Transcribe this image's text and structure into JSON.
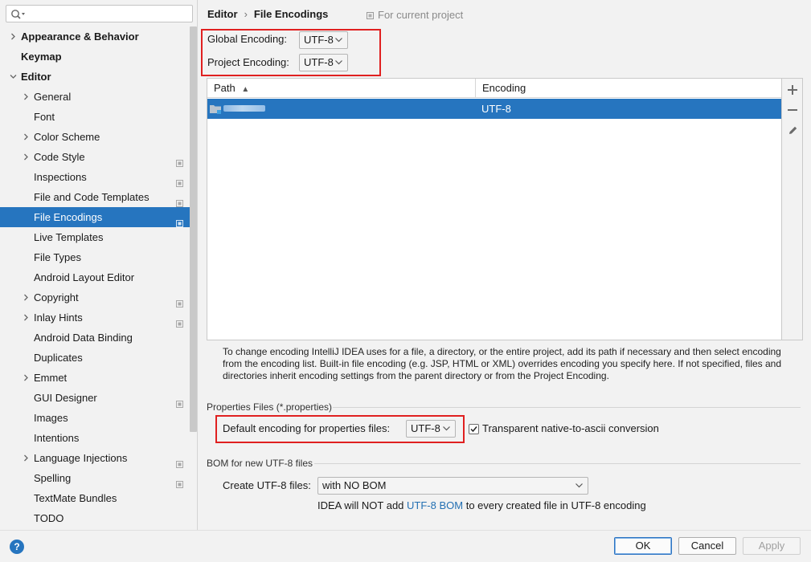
{
  "search": {
    "placeholder": ""
  },
  "sidebar": {
    "items": [
      {
        "label": "Appearance & Behavior",
        "level": 0,
        "expandable": true,
        "expanded": false,
        "project": false
      },
      {
        "label": "Keymap",
        "level": 0,
        "expandable": false,
        "expanded": false,
        "project": false
      },
      {
        "label": "Editor",
        "level": 0,
        "expandable": true,
        "expanded": true,
        "project": false
      },
      {
        "label": "General",
        "level": 1,
        "expandable": true,
        "expanded": false,
        "project": false
      },
      {
        "label": "Font",
        "level": 1,
        "expandable": false,
        "expanded": false,
        "project": false
      },
      {
        "label": "Color Scheme",
        "level": 1,
        "expandable": true,
        "expanded": false,
        "project": false
      },
      {
        "label": "Code Style",
        "level": 1,
        "expandable": true,
        "expanded": false,
        "project": true
      },
      {
        "label": "Inspections",
        "level": 1,
        "expandable": false,
        "expanded": false,
        "project": true
      },
      {
        "label": "File and Code Templates",
        "level": 1,
        "expandable": false,
        "expanded": false,
        "project": true
      },
      {
        "label": "File Encodings",
        "level": 1,
        "expandable": false,
        "expanded": false,
        "project": true,
        "selected": true
      },
      {
        "label": "Live Templates",
        "level": 1,
        "expandable": false,
        "expanded": false,
        "project": false
      },
      {
        "label": "File Types",
        "level": 1,
        "expandable": false,
        "expanded": false,
        "project": false
      },
      {
        "label": "Android Layout Editor",
        "level": 1,
        "expandable": false,
        "expanded": false,
        "project": false
      },
      {
        "label": "Copyright",
        "level": 1,
        "expandable": true,
        "expanded": false,
        "project": true
      },
      {
        "label": "Inlay Hints",
        "level": 1,
        "expandable": true,
        "expanded": false,
        "project": true
      },
      {
        "label": "Android Data Binding",
        "level": 1,
        "expandable": false,
        "expanded": false,
        "project": false
      },
      {
        "label": "Duplicates",
        "level": 1,
        "expandable": false,
        "expanded": false,
        "project": false
      },
      {
        "label": "Emmet",
        "level": 1,
        "expandable": true,
        "expanded": false,
        "project": false
      },
      {
        "label": "GUI Designer",
        "level": 1,
        "expandable": false,
        "expanded": false,
        "project": true
      },
      {
        "label": "Images",
        "level": 1,
        "expandable": false,
        "expanded": false,
        "project": false
      },
      {
        "label": "Intentions",
        "level": 1,
        "expandable": false,
        "expanded": false,
        "project": false
      },
      {
        "label": "Language Injections",
        "level": 1,
        "expandable": true,
        "expanded": false,
        "project": true
      },
      {
        "label": "Spelling",
        "level": 1,
        "expandable": false,
        "expanded": false,
        "project": true
      },
      {
        "label": "TextMate Bundles",
        "level": 1,
        "expandable": false,
        "expanded": false,
        "project": false
      },
      {
        "label": "TODO",
        "level": 1,
        "expandable": false,
        "expanded": false,
        "project": false
      }
    ]
  },
  "breadcrumb": {
    "parent": "Editor",
    "separator": "›",
    "current": "File Encodings",
    "scope": "For current project"
  },
  "global_encoding": {
    "label": "Global Encoding:",
    "value": "UTF-8"
  },
  "project_encoding": {
    "label": "Project Encoding:",
    "value": "UTF-8"
  },
  "table": {
    "columns": [
      "Path",
      "Encoding"
    ],
    "sort_indicator": "▲",
    "rows": [
      {
        "path": "",
        "encoding": "UTF-8"
      }
    ]
  },
  "help_text": "To change encoding IntelliJ IDEA uses for a file, a directory, or the entire project, add its path if necessary and then select encoding from the encoding list. Built-in file encoding (e.g. JSP, HTML or XML) overrides encoding you specify here. If not specified, files and directories inherit encoding settings from the parent directory or from the Project Encoding.",
  "properties": {
    "section_title": "Properties Files (*.properties)",
    "default_label": "Default encoding for properties files:",
    "default_value": "UTF-8",
    "native_label": "Transparent native-to-ascii conversion",
    "native_checked": true
  },
  "bom": {
    "section_title": "BOM for new UTF-8 files",
    "create_label": "Create UTF-8 files:",
    "create_value": "with NO BOM",
    "note_before": "IDEA will NOT add ",
    "note_link": "UTF-8 BOM",
    "note_after": " to every created file in UTF-8 encoding"
  },
  "footer": {
    "help": "?",
    "ok": "OK",
    "cancel": "Cancel",
    "apply": "Apply"
  },
  "colors": {
    "selection": "#2675bf",
    "highlight_box": "#e02020",
    "link": "#2470b3"
  }
}
